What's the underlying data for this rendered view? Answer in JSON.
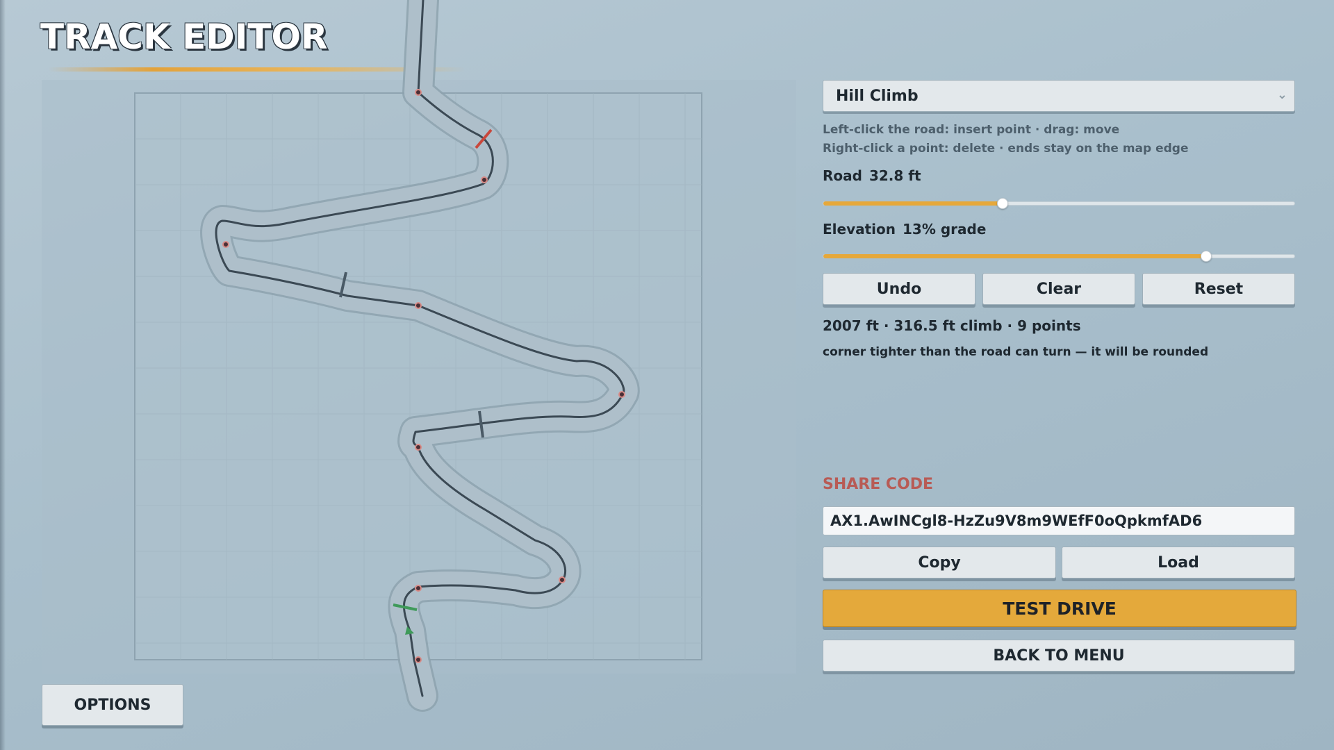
{
  "title": "TRACK EDITOR",
  "track_select": {
    "value": "Hill Climb"
  },
  "hints": {
    "line1": "Left-click the road: insert point  ·  drag: move",
    "line2": "Right-click a point: delete  ·  ends stay on the map edge"
  },
  "road": {
    "label": "Road",
    "value": "32.8 ft",
    "fraction": 0.38
  },
  "elevation": {
    "label": "Elevation",
    "value": "13% grade",
    "fraction": 0.81
  },
  "buttons": {
    "undo": "Undo",
    "clear": "Clear",
    "reset": "Reset",
    "copy": "Copy",
    "load": "Load",
    "test_drive": "TEST DRIVE",
    "back_to_menu": "BACK TO MENU",
    "options": "OPTIONS"
  },
  "stats": "2007 ft  ·  316.5 ft climb  ·  9 points",
  "warning": "corner tighter than the road can turn — it will be rounded",
  "share": {
    "label": "SHARE CODE",
    "code": "AX1.AwINCgl8-HzZu9V8m9WEfF0oQpkmfAD6"
  },
  "colors": {
    "accent": "#e4a93b",
    "share_label": "#b85b55",
    "road": "#3b4954",
    "finish_marker": "#c9483c",
    "start_marker": "#3f9a5a"
  }
}
